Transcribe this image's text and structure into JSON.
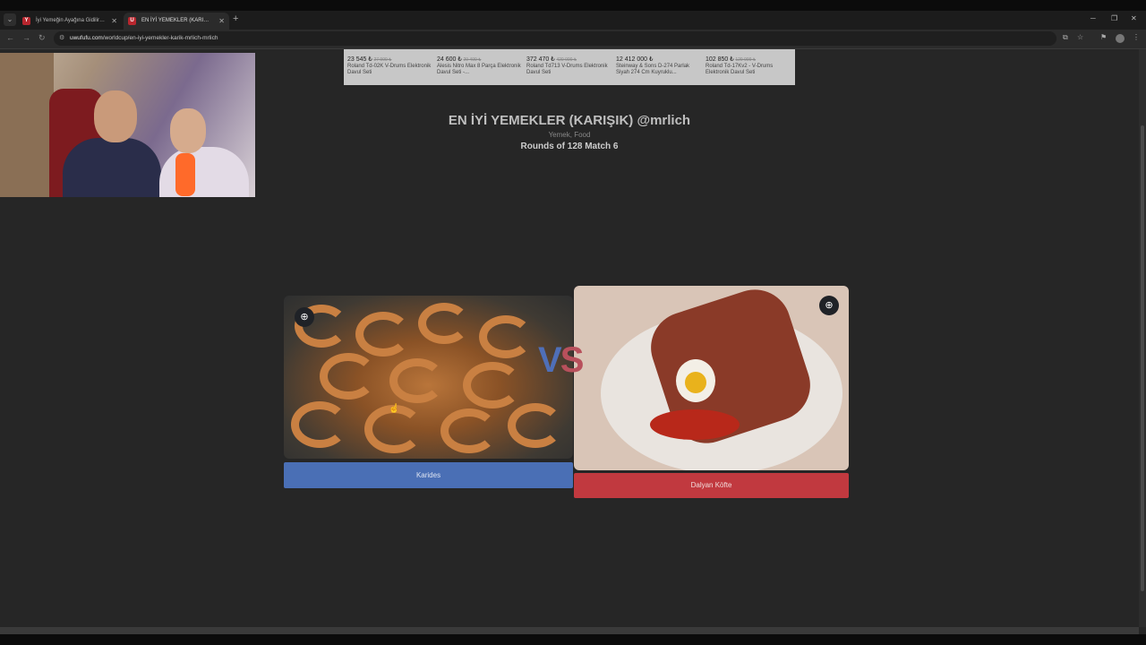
{
  "browser": {
    "tabs": [
      {
        "favicon": "Y",
        "label": "İyi Yemeğin Ayağına Gidilir #8 |"
      },
      {
        "favicon": "U",
        "label": "EN İYİ YEMEKLER (KARIŞIK) @m"
      }
    ],
    "url_host": "uwufufu.com",
    "url_path": "/worldcup/en-iyi-yemekler-karik-mrlich-mrlich"
  },
  "ad": {
    "items": [
      {
        "price": "23 545 ₺",
        "old_price": "27 999 ₺",
        "name": "Roland Td-02K V-Drums Elektronik Davul Seti"
      },
      {
        "price": "24 600 ₺",
        "old_price": "29 499 ₺",
        "name": "Alesis Nitro Max 8 Parça Elektronik Davul Seti -..."
      },
      {
        "price": "372 470 ₺",
        "old_price": "420 000 ₺",
        "name": "Roland Td713 V-Drums Elektronik Davul Seti"
      },
      {
        "price": "12 412 000 ₺",
        "old_price": "",
        "name": "Steinway & Sons D-274 Parlak Siyah 274 Cm Kuyruklu..."
      },
      {
        "price": "102 850 ₺",
        "old_price": "129 999 ₺",
        "name": "Roland Td-17Kv2 - V-Drums Elektronik Davul Seti"
      }
    ]
  },
  "game": {
    "title": "EN İYİ YEMEKLER (KARIŞIK) @mrlich",
    "category": "Yemek, Food",
    "round": "Rounds of 128 Match 6",
    "vs_v": "V",
    "vs_s": "S",
    "left_choice": "Karides",
    "right_choice": "Dalyan Köfte"
  },
  "icons": {
    "zoom": "zoom-in-icon",
    "close": "close-icon",
    "reload": "reload-icon"
  }
}
